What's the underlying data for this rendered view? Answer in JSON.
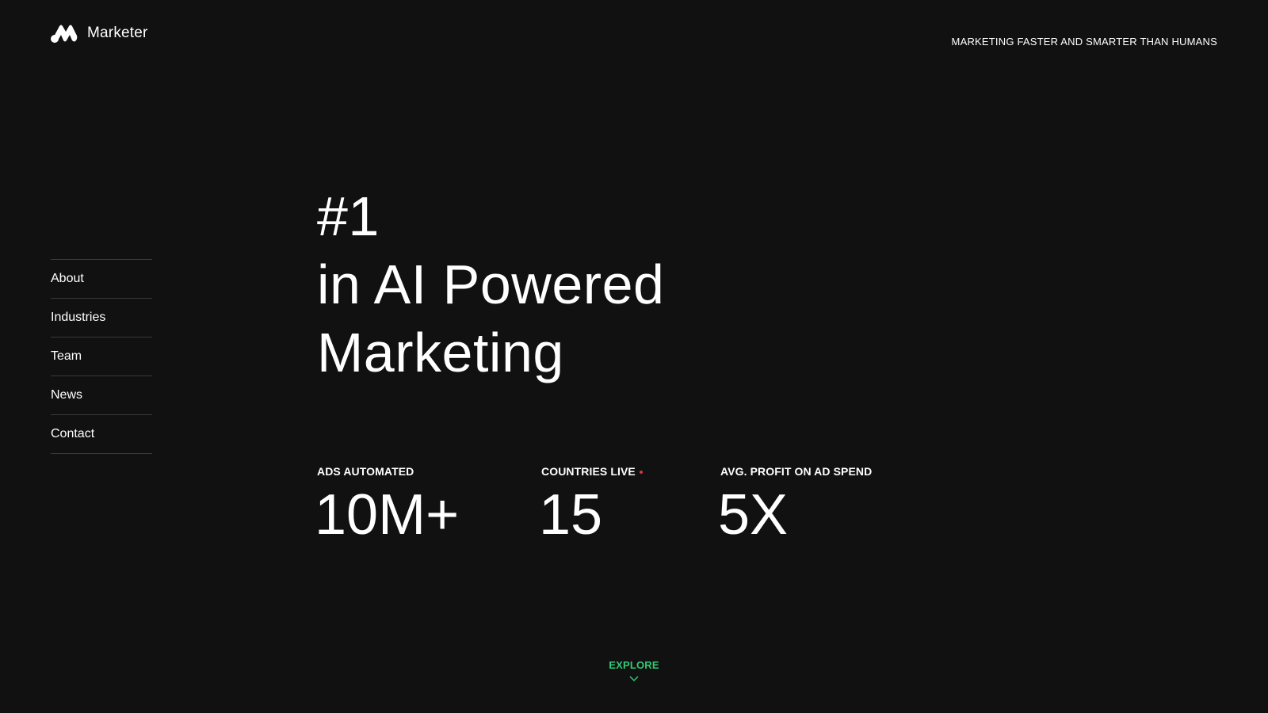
{
  "header": {
    "brand_name": "Marketer",
    "logo_icon": "marketer-m-logo-icon",
    "tagline": "MARKETING FASTER AND SMARTER THAN HUMANS"
  },
  "nav": {
    "items": [
      {
        "label": "About"
      },
      {
        "label": "Industries"
      },
      {
        "label": "Team"
      },
      {
        "label": "News"
      },
      {
        "label": "Contact"
      }
    ]
  },
  "hero": {
    "line1": "#1",
    "line2": "in AI Powered",
    "line3": "Marketing"
  },
  "stats": [
    {
      "label": "ADS AUTOMATED",
      "value": "10M+"
    },
    {
      "label": "COUNTRIES LIVE",
      "value": "15",
      "indicator": "live-dot"
    },
    {
      "label": "AVG. PROFIT ON AD SPEND",
      "value": "5X"
    }
  ],
  "explore": {
    "label": "EXPLORE",
    "icon": "chevron-down-icon"
  },
  "colors": {
    "background": "#111111",
    "text": "#ffffff",
    "accent": "#2fcb76",
    "divider": "#3a3a3a",
    "live_dot": "#d23a3a"
  }
}
